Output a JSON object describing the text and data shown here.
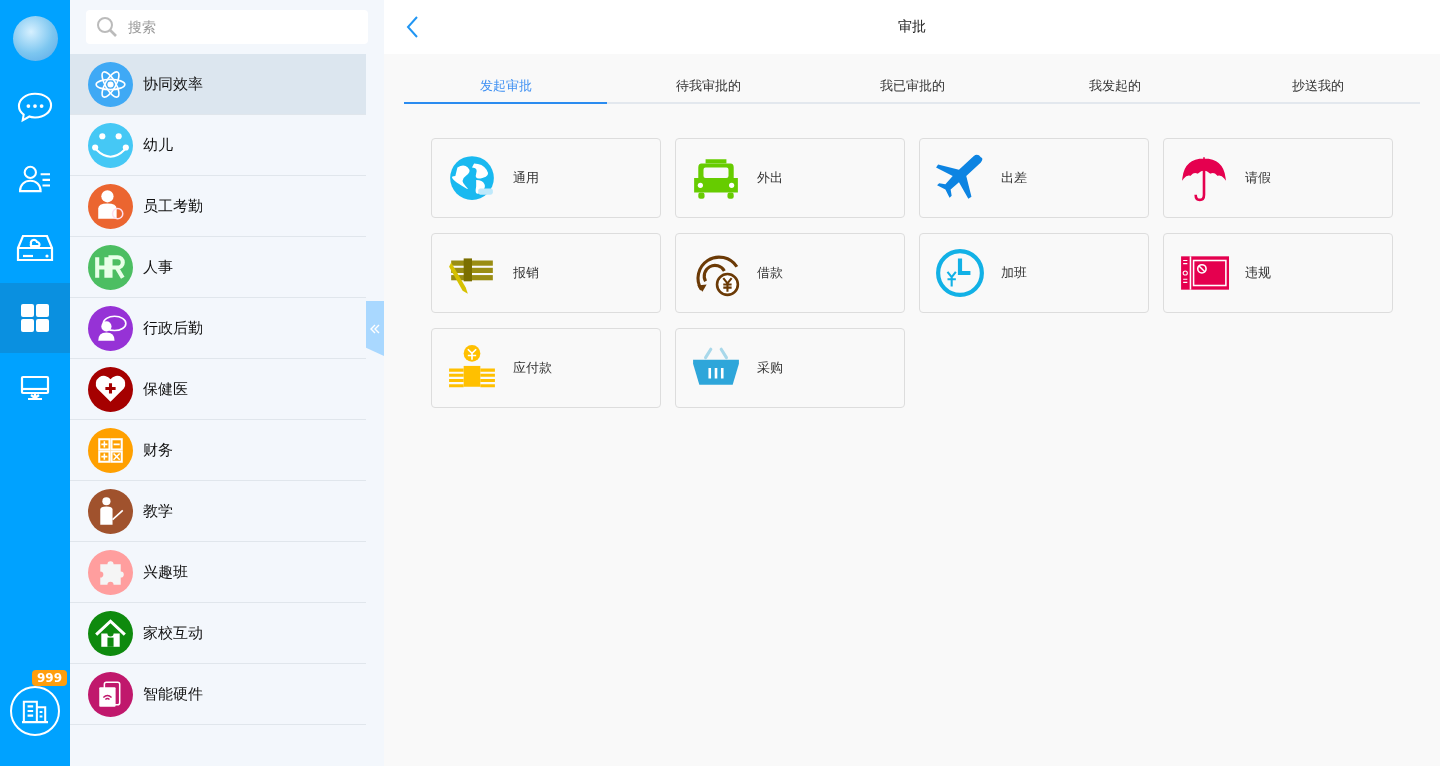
{
  "rail": {
    "items": [
      {
        "selected": false
      },
      {
        "selected": false
      },
      {
        "selected": false
      },
      {
        "selected": true
      },
      {
        "selected": false
      }
    ],
    "badge": "999"
  },
  "sidebar": {
    "search": {
      "placeholder": "搜索"
    },
    "items": [
      {
        "label": "协同效率",
        "color": "#3fa9f5",
        "selected": true
      },
      {
        "label": "幼儿",
        "color": "#45c8f5",
        "selected": false
      },
      {
        "label": "员工考勤",
        "color": "#eb6530",
        "selected": false
      },
      {
        "label": "人事",
        "color": "#4cbe62",
        "selected": false
      },
      {
        "label": "行政后勤",
        "color": "#9632d6",
        "selected": false
      },
      {
        "label": "保健医",
        "color": "#a50000",
        "selected": false
      },
      {
        "label": "财务",
        "color": "#ffa000",
        "selected": false
      },
      {
        "label": "教学",
        "color": "#a0522d",
        "selected": false
      },
      {
        "label": "兴趣班",
        "color": "#ff9e9e",
        "selected": false
      },
      {
        "label": "家校互动",
        "color": "#0e8a0e",
        "selected": false
      },
      {
        "label": "智能硬件",
        "color": "#c0186c",
        "selected": false
      }
    ]
  },
  "main": {
    "title": "审批",
    "tabs": [
      {
        "label": "发起审批",
        "selected": true
      },
      {
        "label": "待我审批的",
        "selected": false
      },
      {
        "label": "我已审批的",
        "selected": false
      },
      {
        "label": "我发起的",
        "selected": false
      },
      {
        "label": "抄送我的",
        "selected": false
      }
    ],
    "cards": [
      {
        "label": "通用"
      },
      {
        "label": "外出"
      },
      {
        "label": "出差"
      },
      {
        "label": "请假"
      },
      {
        "label": "报销"
      },
      {
        "label": "借款"
      },
      {
        "label": "加班"
      },
      {
        "label": "违规"
      },
      {
        "label": "应付款"
      },
      {
        "label": "采购"
      }
    ]
  }
}
